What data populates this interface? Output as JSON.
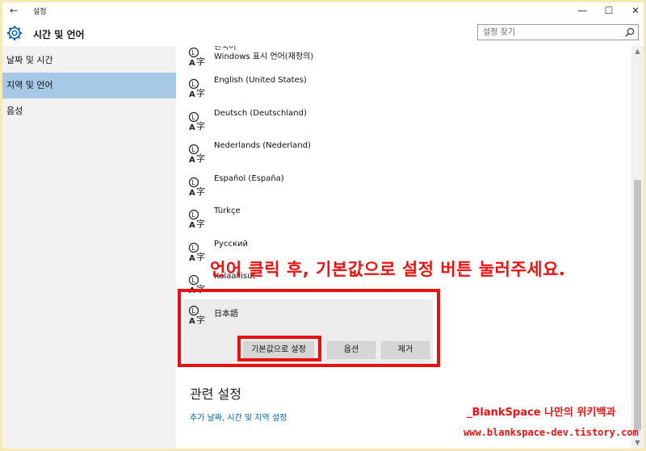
{
  "window": {
    "title": "설정",
    "back_icon": "arrow-left-icon",
    "minimize_icon": "minimize-icon",
    "maximize_icon": "maximize-icon",
    "close_icon": "close-icon"
  },
  "header": {
    "icon": "gear-icon",
    "title": "시간 및 언어",
    "search_placeholder": "설정 찾기",
    "search_icon": "search-icon"
  },
  "sidebar": {
    "items": [
      {
        "label": "날짜 및 시간",
        "selected": false
      },
      {
        "label": "지역 및 언어",
        "selected": true
      },
      {
        "label": "음성",
        "selected": false
      }
    ]
  },
  "languages": [
    {
      "name": "한국어",
      "sub": "Windows 표시 언어(재정의)"
    },
    {
      "name": "English (United States)"
    },
    {
      "name": "Deutsch (Deutschland)"
    },
    {
      "name": "Nederlands (Nederland)"
    },
    {
      "name": "Español (España)"
    },
    {
      "name": "Türkçe"
    },
    {
      "name": "Русский"
    },
    {
      "name": "Kalaallisut"
    },
    {
      "name": "日本語",
      "selected": true
    }
  ],
  "selected_actions": {
    "set_default": "기본값으로 설정",
    "options": "옵션",
    "remove": "제거"
  },
  "related": {
    "heading": "관련 설정",
    "link": "추가 날짜, 시간 및 지역 설정"
  },
  "annotation": {
    "text": "언어 클릭 후, 기본값으로 설정 버튼 눌러주세요.",
    "watermark_name": "_BlankSpace 나만의 위키백과",
    "watermark_url": "www.blankspace-dev.tistory.com",
    "color": "#ee1111"
  },
  "colors": {
    "sidebar_selected": "#a8c8e8",
    "link": "#0063b1",
    "accent": "#0063b1"
  }
}
